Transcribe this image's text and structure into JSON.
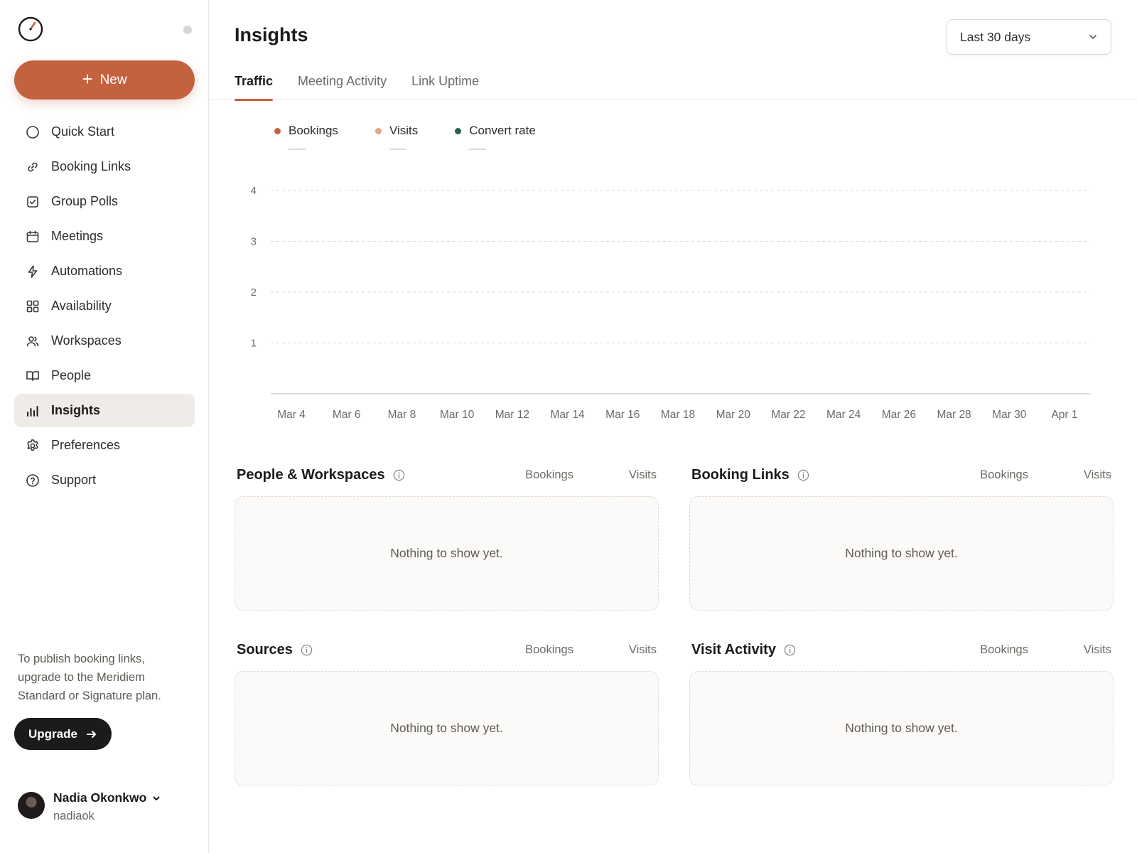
{
  "app": {
    "accent_color": "#c4623f"
  },
  "sidebar": {
    "new_button_label": "New",
    "items": [
      {
        "label": "Quick Start",
        "icon": "circle-icon"
      },
      {
        "label": "Booking Links",
        "icon": "link-icon"
      },
      {
        "label": "Group Polls",
        "icon": "checkbox-icon"
      },
      {
        "label": "Meetings",
        "icon": "calendar-icon"
      },
      {
        "label": "Automations",
        "icon": "lightning-icon"
      },
      {
        "label": "Availability",
        "icon": "grid-icon"
      },
      {
        "label": "Workspaces",
        "icon": "users-icon"
      },
      {
        "label": "People",
        "icon": "book-icon"
      },
      {
        "label": "Insights",
        "icon": "bar-chart-icon",
        "active": true
      },
      {
        "label": "Preferences",
        "icon": "gear-icon"
      },
      {
        "label": "Support",
        "icon": "help-icon"
      }
    ],
    "upgrade_text": "To publish booking links, upgrade to the Meridiem Standard or Signature plan.",
    "upgrade_button_label": "Upgrade",
    "user": {
      "name": "Nadia Okonkwo",
      "handle": "nadiaok"
    }
  },
  "header": {
    "title": "Insights",
    "date_range": "Last 30 days"
  },
  "tabs": [
    {
      "label": "Traffic",
      "active": true
    },
    {
      "label": "Meeting Activity",
      "active": false
    },
    {
      "label": "Link Uptime",
      "active": false
    }
  ],
  "chart_data": {
    "type": "line",
    "series": [
      {
        "name": "Bookings",
        "color": "#c4623f",
        "values": []
      },
      {
        "name": "Visits",
        "color": "#e0a58c",
        "values": []
      },
      {
        "name": "Convert rate",
        "color": "#2e5e4e",
        "values": []
      }
    ],
    "categories": [
      "Mar 4",
      "Mar 6",
      "Mar 8",
      "Mar 10",
      "Mar 12",
      "Mar 14",
      "Mar 16",
      "Mar 18",
      "Mar 20",
      "Mar 22",
      "Mar 24",
      "Mar 26",
      "Mar 28",
      "Mar 30",
      "Apr 1"
    ],
    "y_ticks": [
      "1",
      "2",
      "3",
      "4"
    ],
    "ylim": [
      0,
      4
    ],
    "grid": true,
    "legend_placement": "top-left"
  },
  "cards": [
    {
      "title": "People & Workspaces",
      "col1": "Bookings",
      "col2": "Visits",
      "empty": "Nothing to show yet."
    },
    {
      "title": "Booking Links",
      "col1": "Bookings",
      "col2": "Visits",
      "empty": "Nothing to show yet."
    },
    {
      "title": "Sources",
      "col1": "Bookings",
      "col2": "Visits",
      "empty": "Nothing to show yet."
    },
    {
      "title": "Visit Activity",
      "col1": "Bookings",
      "col2": "Visits",
      "empty": "Nothing to show yet."
    }
  ]
}
